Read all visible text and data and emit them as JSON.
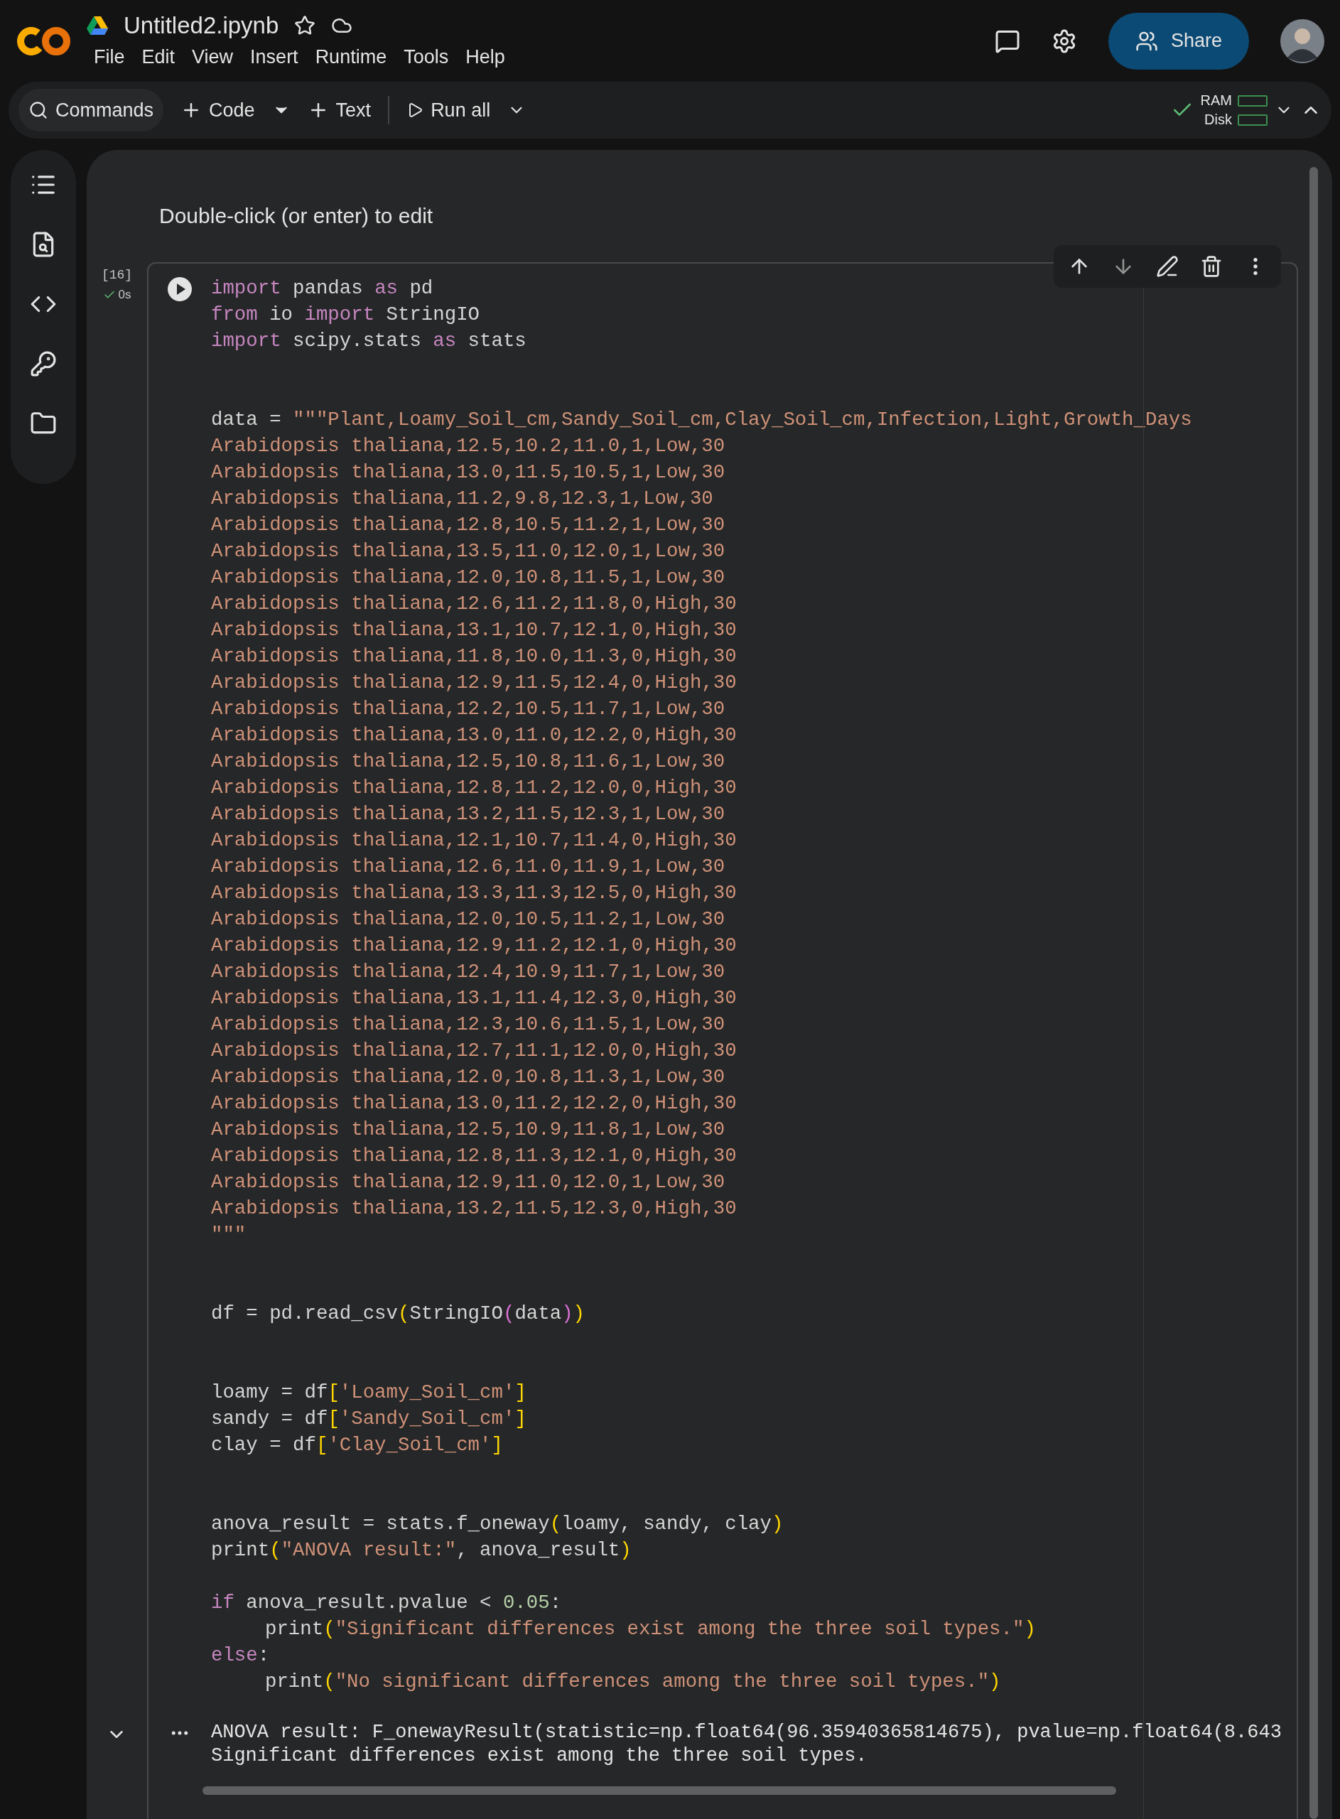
{
  "header": {
    "title": "Untitled2.ipynb",
    "menu": [
      "File",
      "Edit",
      "View",
      "Insert",
      "Runtime",
      "Tools",
      "Help"
    ],
    "share": "Share"
  },
  "toolbar": {
    "commands": "Commands",
    "code": "Code",
    "text": "Text",
    "run_all": "Run all",
    "ram": "RAM",
    "disk": "Disk"
  },
  "notebook": {
    "text_cell": "Double-click (or enter) to edit",
    "cell": {
      "execution_count": "[16]",
      "duration": "0s",
      "lines": [
        {
          "kind": "code",
          "tokens": [
            {
              "kind": "keyword",
              "text": "import"
            },
            {
              "kind": "plain",
              "text": " pandas "
            },
            {
              "kind": "keyword",
              "text": "as"
            },
            {
              "kind": "plain",
              "text": " pd"
            }
          ]
        },
        {
          "kind": "code",
          "tokens": [
            {
              "kind": "keyword",
              "text": "from"
            },
            {
              "kind": "plain",
              "text": " io "
            },
            {
              "kind": "keyword",
              "text": "import"
            },
            {
              "kind": "plain",
              "text": " StringIO"
            }
          ]
        },
        {
          "kind": "code",
          "tokens": [
            {
              "kind": "keyword",
              "text": "import"
            },
            {
              "kind": "plain",
              "text": " scipy.stats "
            },
            {
              "kind": "keyword",
              "text": "as"
            },
            {
              "kind": "plain",
              "text": " stats"
            }
          ]
        },
        {
          "kind": "blank"
        },
        {
          "kind": "blank"
        },
        {
          "kind": "code",
          "tokens": [
            {
              "kind": "plain",
              "text": "data = "
            },
            {
              "kind": "string",
              "text": "\"\"\"Plant,Loamy_Soil_cm,Sandy_Soil_cm,Clay_Soil_cm,Infection,Light,Growth_Days"
            }
          ]
        },
        {
          "kind": "code",
          "tokens": [
            {
              "kind": "string",
              "text": "Arabidopsis thaliana,12.5,10.2,11.0,1,Low,30"
            }
          ]
        },
        {
          "kind": "code",
          "tokens": [
            {
              "kind": "string",
              "text": "Arabidopsis thaliana,13.0,11.5,10.5,1,Low,30"
            }
          ]
        },
        {
          "kind": "code",
          "tokens": [
            {
              "kind": "string",
              "text": "Arabidopsis thaliana,11.2,9.8,12.3,1,Low,30"
            }
          ]
        },
        {
          "kind": "code",
          "tokens": [
            {
              "kind": "string",
              "text": "Arabidopsis thaliana,12.8,10.5,11.2,1,Low,30"
            }
          ]
        },
        {
          "kind": "code",
          "tokens": [
            {
              "kind": "string",
              "text": "Arabidopsis thaliana,13.5,11.0,12.0,1,Low,30"
            }
          ]
        },
        {
          "kind": "code",
          "tokens": [
            {
              "kind": "string",
              "text": "Arabidopsis thaliana,12.0,10.8,11.5,1,Low,30"
            }
          ]
        },
        {
          "kind": "code",
          "tokens": [
            {
              "kind": "string",
              "text": "Arabidopsis thaliana,12.6,11.2,11.8,0,High,30"
            }
          ]
        },
        {
          "kind": "code",
          "tokens": [
            {
              "kind": "string",
              "text": "Arabidopsis thaliana,13.1,10.7,12.1,0,High,30"
            }
          ]
        },
        {
          "kind": "code",
          "tokens": [
            {
              "kind": "string",
              "text": "Arabidopsis thaliana,11.8,10.0,11.3,0,High,30"
            }
          ]
        },
        {
          "kind": "code",
          "tokens": [
            {
              "kind": "string",
              "text": "Arabidopsis thaliana,12.9,11.5,12.4,0,High,30"
            }
          ]
        },
        {
          "kind": "code",
          "tokens": [
            {
              "kind": "string",
              "text": "Arabidopsis thaliana,12.2,10.5,11.7,1,Low,30"
            }
          ]
        },
        {
          "kind": "code",
          "tokens": [
            {
              "kind": "string",
              "text": "Arabidopsis thaliana,13.0,11.0,12.2,0,High,30"
            }
          ]
        },
        {
          "kind": "code",
          "tokens": [
            {
              "kind": "string",
              "text": "Arabidopsis thaliana,12.5,10.8,11.6,1,Low,30"
            }
          ]
        },
        {
          "kind": "code",
          "tokens": [
            {
              "kind": "string",
              "text": "Arabidopsis thaliana,12.8,11.2,12.0,0,High,30"
            }
          ]
        },
        {
          "kind": "code",
          "tokens": [
            {
              "kind": "string",
              "text": "Arabidopsis thaliana,13.2,11.5,12.3,1,Low,30"
            }
          ]
        },
        {
          "kind": "code",
          "tokens": [
            {
              "kind": "string",
              "text": "Arabidopsis thaliana,12.1,10.7,11.4,0,High,30"
            }
          ]
        },
        {
          "kind": "code",
          "tokens": [
            {
              "kind": "string",
              "text": "Arabidopsis thaliana,12.6,11.0,11.9,1,Low,30"
            }
          ]
        },
        {
          "kind": "code",
          "tokens": [
            {
              "kind": "string",
              "text": "Arabidopsis thaliana,13.3,11.3,12.5,0,High,30"
            }
          ]
        },
        {
          "kind": "code",
          "tokens": [
            {
              "kind": "string",
              "text": "Arabidopsis thaliana,12.0,10.5,11.2,1,Low,30"
            }
          ]
        },
        {
          "kind": "code",
          "tokens": [
            {
              "kind": "string",
              "text": "Arabidopsis thaliana,12.9,11.2,12.1,0,High,30"
            }
          ]
        },
        {
          "kind": "code",
          "tokens": [
            {
              "kind": "string",
              "text": "Arabidopsis thaliana,12.4,10.9,11.7,1,Low,30"
            }
          ]
        },
        {
          "kind": "code",
          "tokens": [
            {
              "kind": "string",
              "text": "Arabidopsis thaliana,13.1,11.4,12.3,0,High,30"
            }
          ]
        },
        {
          "kind": "code",
          "tokens": [
            {
              "kind": "string",
              "text": "Arabidopsis thaliana,12.3,10.6,11.5,1,Low,30"
            }
          ]
        },
        {
          "kind": "code",
          "tokens": [
            {
              "kind": "string",
              "text": "Arabidopsis thaliana,12.7,11.1,12.0,0,High,30"
            }
          ]
        },
        {
          "kind": "code",
          "tokens": [
            {
              "kind": "string",
              "text": "Arabidopsis thaliana,12.0,10.8,11.3,1,Low,30"
            }
          ]
        },
        {
          "kind": "code",
          "tokens": [
            {
              "kind": "string",
              "text": "Arabidopsis thaliana,13.0,11.2,12.2,0,High,30"
            }
          ]
        },
        {
          "kind": "code",
          "tokens": [
            {
              "kind": "string",
              "text": "Arabidopsis thaliana,12.5,10.9,11.8,1,Low,30"
            }
          ]
        },
        {
          "kind": "code",
          "tokens": [
            {
              "kind": "string",
              "text": "Arabidopsis thaliana,12.8,11.3,12.1,0,High,30"
            }
          ]
        },
        {
          "kind": "code",
          "tokens": [
            {
              "kind": "string",
              "text": "Arabidopsis thaliana,12.9,11.0,12.0,1,Low,30"
            }
          ]
        },
        {
          "kind": "code",
          "tokens": [
            {
              "kind": "string",
              "text": "Arabidopsis thaliana,13.2,11.5,12.3,0,High,30"
            }
          ]
        },
        {
          "kind": "code",
          "tokens": [
            {
              "kind": "string",
              "text": "\"\"\""
            }
          ]
        },
        {
          "kind": "blank"
        },
        {
          "kind": "blank"
        },
        {
          "kind": "code",
          "tokens": [
            {
              "kind": "plain",
              "text": "df = pd.read_csv"
            },
            {
              "kind": "bracket",
              "text": "("
            },
            {
              "kind": "plain",
              "text": "StringIO"
            },
            {
              "kind": "bracket2",
              "text": "("
            },
            {
              "kind": "plain",
              "text": "data"
            },
            {
              "kind": "bracket2",
              "text": ")"
            },
            {
              "kind": "bracket",
              "text": ")"
            }
          ]
        },
        {
          "kind": "blank"
        },
        {
          "kind": "blank"
        },
        {
          "kind": "code",
          "tokens": [
            {
              "kind": "plain",
              "text": "loamy = df"
            },
            {
              "kind": "bracket",
              "text": "["
            },
            {
              "kind": "string",
              "text": "'Loamy_Soil_cm'"
            },
            {
              "kind": "bracket",
              "text": "]"
            }
          ]
        },
        {
          "kind": "code",
          "tokens": [
            {
              "kind": "plain",
              "text": "sandy = df"
            },
            {
              "kind": "bracket",
              "text": "["
            },
            {
              "kind": "string",
              "text": "'Sandy_Soil_cm'"
            },
            {
              "kind": "bracket",
              "text": "]"
            }
          ]
        },
        {
          "kind": "code",
          "tokens": [
            {
              "kind": "plain",
              "text": "clay = df"
            },
            {
              "kind": "bracket",
              "text": "["
            },
            {
              "kind": "string",
              "text": "'Clay_Soil_cm'"
            },
            {
              "kind": "bracket",
              "text": "]"
            }
          ]
        },
        {
          "kind": "blank"
        },
        {
          "kind": "blank"
        },
        {
          "kind": "code",
          "tokens": [
            {
              "kind": "plain",
              "text": "anova_result = stats.f_oneway"
            },
            {
              "kind": "bracket",
              "text": "("
            },
            {
              "kind": "plain",
              "text": "loamy, sandy, clay"
            },
            {
              "kind": "bracket",
              "text": ")"
            }
          ]
        },
        {
          "kind": "code",
          "tokens": [
            {
              "kind": "plain",
              "text": "print"
            },
            {
              "kind": "bracket",
              "text": "("
            },
            {
              "kind": "string",
              "text": "\"ANOVA result:\""
            },
            {
              "kind": "plain",
              "text": ", anova_result"
            },
            {
              "kind": "bracket",
              "text": ")"
            }
          ]
        },
        {
          "kind": "blank"
        },
        {
          "kind": "code",
          "tokens": [
            {
              "kind": "keyword",
              "text": "if"
            },
            {
              "kind": "plain",
              "text": " anova_result.pvalue < "
            },
            {
              "kind": "number",
              "text": "0.05"
            },
            {
              "kind": "plain",
              "text": ":"
            }
          ]
        },
        {
          "kind": "indented",
          "tokens": [
            {
              "kind": "plain",
              "text": "print"
            },
            {
              "kind": "bracket",
              "text": "("
            },
            {
              "kind": "string",
              "text": "\"Significant differences exist among the three soil types.\""
            },
            {
              "kind": "bracket",
              "text": ")"
            }
          ]
        },
        {
          "kind": "code",
          "tokens": [
            {
              "kind": "keyword",
              "text": "else"
            },
            {
              "kind": "plain",
              "text": ":"
            }
          ]
        },
        {
          "kind": "indented",
          "tokens": [
            {
              "kind": "plain",
              "text": "print"
            },
            {
              "kind": "bracket",
              "text": "("
            },
            {
              "kind": "string",
              "text": "\"No significant differences among the three soil types.\""
            },
            {
              "kind": "bracket",
              "text": ")"
            }
          ]
        }
      ],
      "output": [
        "ANOVA result: F_onewayResult(statistic=np.float64(96.35940365814675), pvalue=np.float64(8.643",
        "Significant differences exist among the three soil types."
      ]
    }
  }
}
